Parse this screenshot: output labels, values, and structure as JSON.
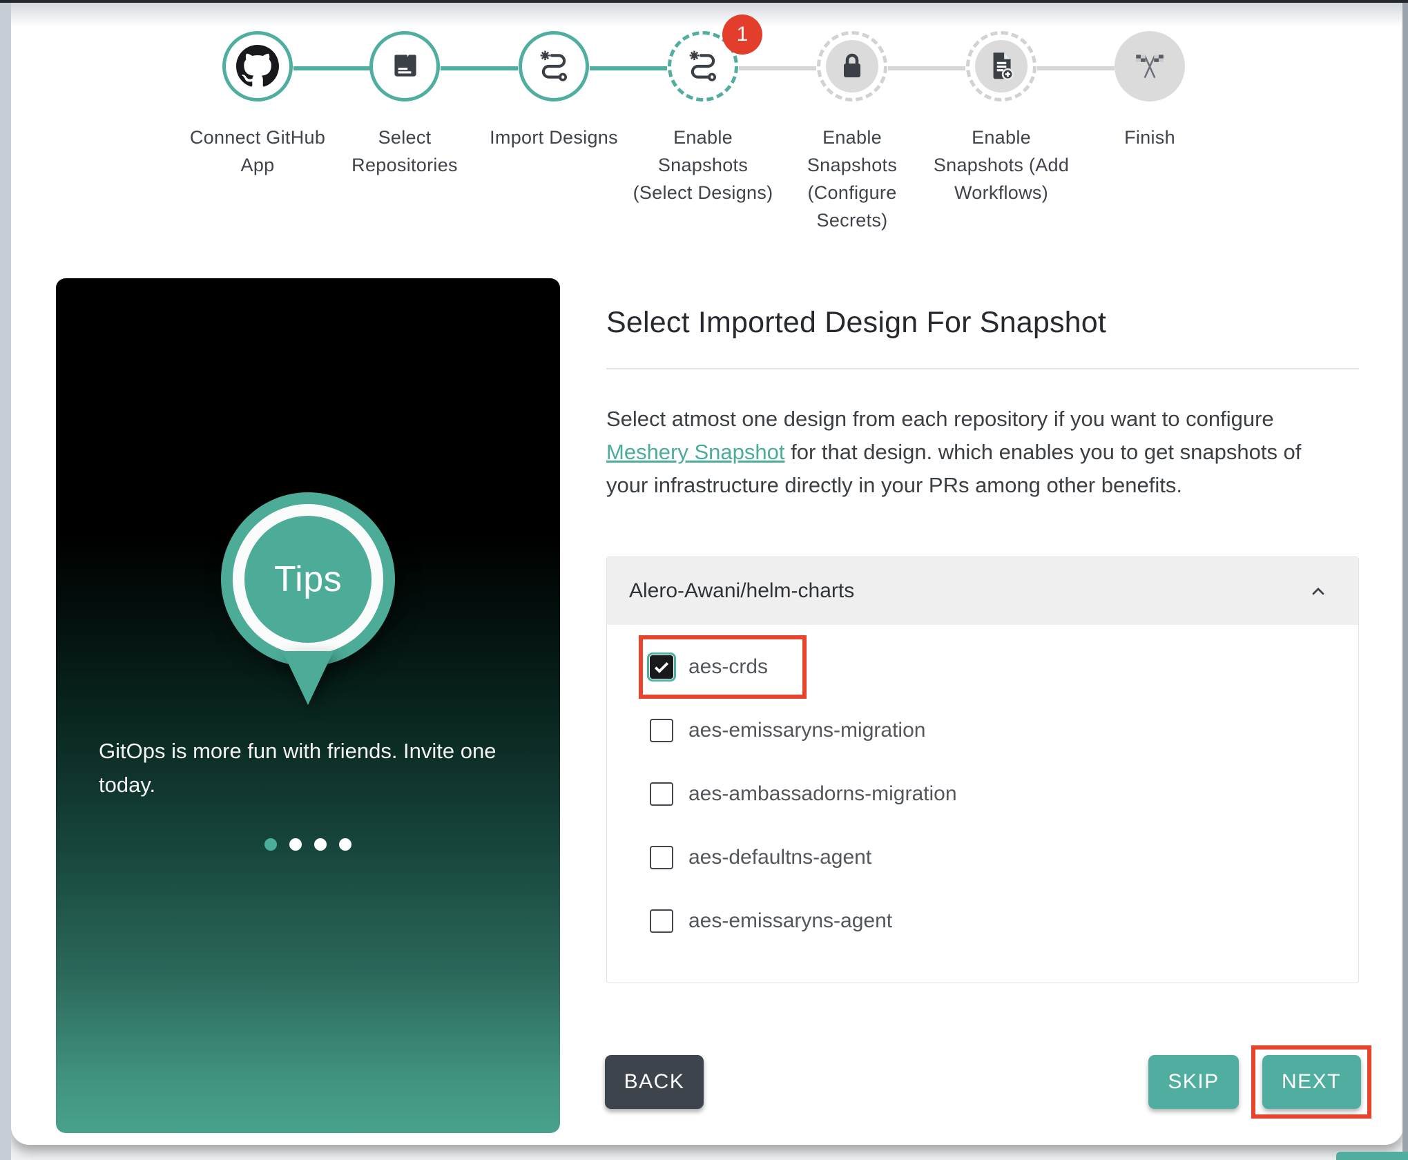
{
  "colors": {
    "teal": "#4FAE9F",
    "annotation_red": "#E8432B",
    "badge_red": "#E33E2B",
    "dark_button": "#3D444B"
  },
  "stepper": {
    "steps": [
      {
        "label": "Connect GitHub\nApp",
        "icon": "github",
        "icon_name": "github-icon",
        "state": "completed"
      },
      {
        "label": "Select\nRepositories",
        "icon": "repository",
        "icon_name": "repository-icon",
        "state": "completed"
      },
      {
        "label": "Import Designs",
        "icon": "route",
        "icon_name": "route-icon",
        "state": "completed"
      },
      {
        "label": "Enable\nSnapshots\n(Select Designs)",
        "icon": "route",
        "icon_name": "route-icon",
        "state": "active",
        "badge": "1"
      },
      {
        "label": "Enable\nSnapshots\n(Configure\nSecrets)",
        "icon": "lock",
        "icon_name": "lock-icon",
        "state": "pending"
      },
      {
        "label": "Enable\nSnapshots (Add\nWorkflows)",
        "icon": "document-add",
        "icon_name": "document-add-icon",
        "state": "pending"
      },
      {
        "label": "Finish",
        "icon": "finish-flags",
        "icon_name": "finish-flags-icon",
        "state": "pending"
      }
    ]
  },
  "tips": {
    "badge": "Tips",
    "message": "GitOps is more fun with friends. Invite one\ntoday.",
    "dots": [
      {
        "active": true
      },
      {
        "active": false
      },
      {
        "active": false
      },
      {
        "active": false
      }
    ]
  },
  "content": {
    "title": "Select Imported Design For Snapshot",
    "description": {
      "before_link": "Select atmost one design from each repository if you want to configure ",
      "link_text": "Meshery Snapshot",
      "after_link": " for that design. which enables you to get snapshots of your infrastructure directly in your PRs among other benefits."
    },
    "repository": {
      "name": "Alero-Awani/helm-charts",
      "expanded": true,
      "designs": [
        {
          "label": "aes-crds",
          "checked": true,
          "highlighted": true
        },
        {
          "label": "aes-emissaryns-migration",
          "checked": false
        },
        {
          "label": "aes-ambassadorns-migration",
          "checked": false
        },
        {
          "label": "aes-defaultns-agent",
          "checked": false
        },
        {
          "label": "aes-emissaryns-agent",
          "checked": false
        }
      ]
    },
    "actions": {
      "back": "BACK",
      "skip": "SKIP",
      "next": "NEXT"
    }
  }
}
